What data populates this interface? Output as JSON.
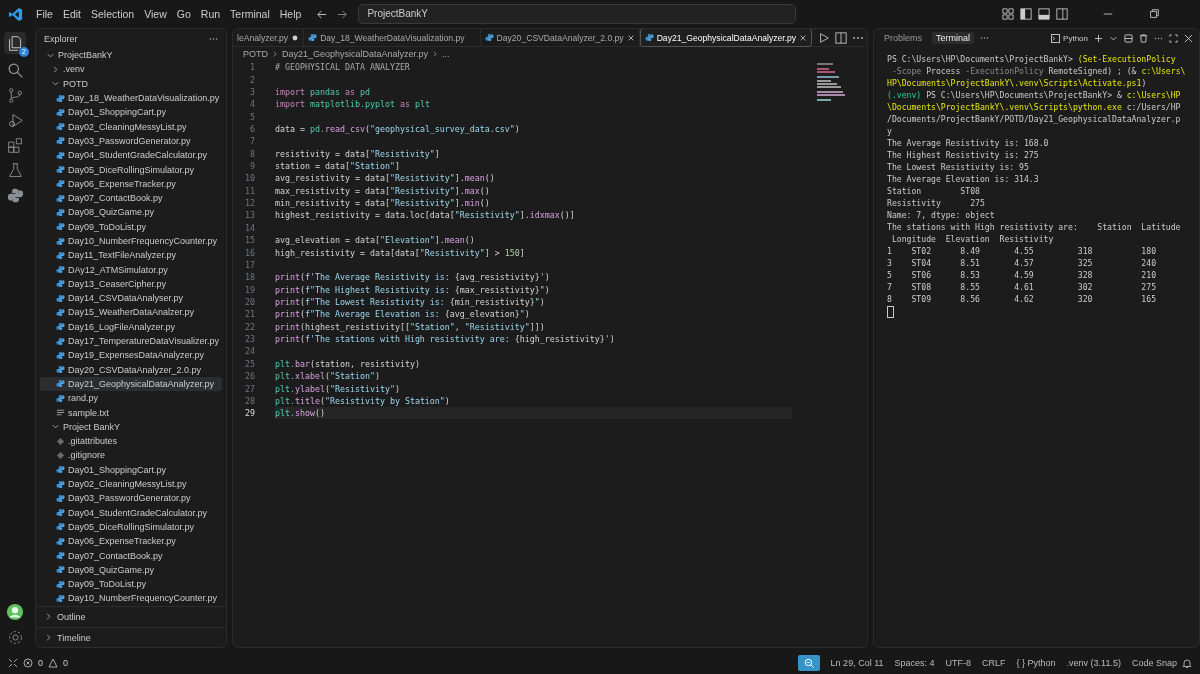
{
  "title_bar": {
    "menu": [
      "File",
      "Edit",
      "Selection",
      "View",
      "Go",
      "Run",
      "Terminal",
      "Help"
    ],
    "search": {
      "value": "ProjectBankY"
    }
  },
  "activity_bar": {
    "badge": "2"
  },
  "explorer": {
    "title": "Explorer",
    "tree": [
      {
        "label": "ProjectBankY",
        "kind": "folder",
        "expanded": true,
        "selected": false,
        "children": [
          {
            "label": ".venv",
            "kind": "folder",
            "expanded": false,
            "selected": false
          },
          {
            "label": "POTD",
            "kind": "folder",
            "expanded": true,
            "selected": false,
            "children": [
              {
                "label": "Day_18_WeatherDataVisualization.py",
                "kind": "python",
                "selected": false
              },
              {
                "label": "Day01_ShoppingCart.py",
                "kind": "python",
                "selected": false
              },
              {
                "label": "Day02_CleaningMessyList.py",
                "kind": "python",
                "selected": false
              },
              {
                "label": "Day03_PasswordGenerator.py",
                "kind": "python",
                "selected": false
              },
              {
                "label": "Day04_StudentGradeCalculator.py",
                "kind": "python",
                "selected": false
              },
              {
                "label": "Day05_DiceRollingSimulator.py",
                "kind": "python",
                "selected": false
              },
              {
                "label": "Day06_ExpenseTracker.py",
                "kind": "python",
                "selected": false
              },
              {
                "label": "Day07_ContactBook.py",
                "kind": "python",
                "selected": false
              },
              {
                "label": "Day08_QuizGame.py",
                "kind": "python",
                "selected": false
              },
              {
                "label": "Day09_ToDoList.py",
                "kind": "python",
                "selected": false
              },
              {
                "label": "Day10_NumberFrequencyCounter.py",
                "kind": "python",
                "selected": false
              },
              {
                "label": "Day11_TextFileAnalyzer.py",
                "kind": "python",
                "selected": false
              },
              {
                "label": "DAy12_ATMSimulator.py",
                "kind": "python",
                "selected": false
              },
              {
                "label": "Day13_CeaserCipher.py",
                "kind": "python",
                "selected": false
              },
              {
                "label": "Day14_CSVDataAnalyser.py",
                "kind": "python",
                "selected": false
              },
              {
                "label": "Day15_WeatherDataAnalzer.py",
                "kind": "python",
                "selected": false
              },
              {
                "label": "Day16_LogFileAnalyzer.py",
                "kind": "python",
                "selected": false
              },
              {
                "label": "Day17_TemperatureDataVisualizer.py",
                "kind": "python",
                "selected": false
              },
              {
                "label": "Day19_ExpensesDataAnalyzer.py",
                "kind": "python",
                "selected": false
              },
              {
                "label": "Day20_CSVDataAnalyzer_2.0.py",
                "kind": "python",
                "selected": false
              },
              {
                "label": "Day21_GeophysicalDataAnalyzer.py",
                "kind": "python",
                "selected": true
              },
              {
                "label": "rand.py",
                "kind": "python",
                "selected": false
              },
              {
                "label": "sample.txt",
                "kind": "text",
                "selected": false
              }
            ]
          },
          {
            "label": "Project BankY",
            "kind": "folder",
            "expanded": true,
            "selected": false,
            "children": [
              {
                "label": ".gitattributes",
                "kind": "git",
                "selected": false
              },
              {
                "label": ".gitignore",
                "kind": "git",
                "selected": false
              },
              {
                "label": "Day01_ShoppingCart.py",
                "kind": "python",
                "selected": false
              },
              {
                "label": "Day02_CleaningMessyList.py",
                "kind": "python",
                "selected": false
              },
              {
                "label": "Day03_PasswordGenerator.py",
                "kind": "python",
                "selected": false
              },
              {
                "label": "Day04_StudentGradeCalculator.py",
                "kind": "python",
                "selected": false
              },
              {
                "label": "Day05_DiceRollingSimulator.py",
                "kind": "python",
                "selected": false
              },
              {
                "label": "Day06_ExpenseTracker.py",
                "kind": "python",
                "selected": false
              },
              {
                "label": "Day07_ContactBook.py",
                "kind": "python",
                "selected": false
              },
              {
                "label": "Day08_QuizGame.py",
                "kind": "python",
                "selected": false
              },
              {
                "label": "Day09_ToDoList.py",
                "kind": "python",
                "selected": false
              },
              {
                "label": "Day10_NumberFrequencyCounter.py",
                "kind": "python",
                "selected": false
              }
            ]
          }
        ]
      }
    ],
    "sections": [
      {
        "label": "Outline",
        "expanded": false
      },
      {
        "label": "Timeline",
        "expanded": false
      }
    ]
  },
  "tabs": [
    {
      "label": "leAnalyzer.py",
      "kind": "partial",
      "selected": false,
      "modified": true
    },
    {
      "label": "Day_18_WeatherDataVisualization.py",
      "kind": "python",
      "selected": false,
      "modified": false,
      "close_visible": false
    },
    {
      "label": "Day20_CSVDataAnalyzer_2.0.py",
      "kind": "python",
      "selected": false,
      "modified": false,
      "close_visible": true
    },
    {
      "label": "Day21_GeophysicalDataAnalyzer.py",
      "kind": "python",
      "selected": true,
      "modified": false,
      "close_visible": true
    }
  ],
  "breadcrumb": [
    "POTD",
    "Day21_GeophysicalDataAnalyzer.py",
    "..."
  ],
  "code": [
    {
      "number": "1",
      "current": false,
      "tokens": [
        {
          "text": "# GEOPHYSICAL DATA ANALYZER",
          "kind": "comment"
        }
      ]
    },
    {
      "number": "2",
      "current": false
    },
    {
      "number": "3",
      "current": false,
      "tokens": [
        {
          "text": "import",
          "kind": "kw"
        },
        {
          "text": " pandas",
          "kind": "mod"
        },
        {
          "text": " as",
          "kind": "kw"
        },
        {
          "text": " pd",
          "kind": "mod"
        }
      ]
    },
    {
      "number": "4",
      "current": false,
      "tokens": [
        {
          "text": "import",
          "kind": "kw"
        },
        {
          "text": " matplotlib.pyplot",
          "kind": "mod"
        },
        {
          "text": " as",
          "kind": "kw"
        },
        {
          "text": " plt",
          "kind": "mod"
        }
      ]
    },
    {
      "number": "5",
      "current": false
    },
    {
      "number": "6",
      "current": false,
      "tokens": [
        {
          "text": "data = ",
          "kind": "plain"
        },
        {
          "text": "pd.",
          "kind": "mod"
        },
        {
          "text": "read_csv",
          "kind": "fn"
        },
        {
          "text": "(",
          "kind": "plain"
        },
        {
          "text": "\"geophysical_survey_data.csv\"",
          "kind": "str"
        },
        {
          "text": ")",
          "kind": "plain"
        }
      ]
    },
    {
      "number": "7",
      "current": false
    },
    {
      "number": "8",
      "current": false,
      "tokens": [
        {
          "text": "resistivity = data[",
          "kind": "plain"
        },
        {
          "text": "\"Resistivity\"",
          "kind": "str"
        },
        {
          "text": "]",
          "kind": "plain"
        }
      ]
    },
    {
      "number": "9",
      "current": false,
      "tokens": [
        {
          "text": "station = data[",
          "kind": "plain"
        },
        {
          "text": "\"Station\"",
          "kind": "str"
        },
        {
          "text": "]",
          "kind": "plain"
        }
      ]
    },
    {
      "number": "10",
      "current": false,
      "tokens": [
        {
          "text": "avg_resistivity = data[",
          "kind": "plain"
        },
        {
          "text": "\"Resistivity\"",
          "kind": "str"
        },
        {
          "text": "].",
          "kind": "plain"
        },
        {
          "text": "mean",
          "kind": "fn"
        },
        {
          "text": "()",
          "kind": "plain"
        }
      ]
    },
    {
      "number": "11",
      "current": false,
      "tokens": [
        {
          "text": "max_resistivity = data[",
          "kind": "plain"
        },
        {
          "text": "\"Resistivity\"",
          "kind": "str"
        },
        {
          "text": "].",
          "kind": "plain"
        },
        {
          "text": "max",
          "kind": "fn"
        },
        {
          "text": "()",
          "kind": "plain"
        }
      ]
    },
    {
      "number": "12",
      "current": false,
      "tokens": [
        {
          "text": "min_resistivity = data[",
          "kind": "plain"
        },
        {
          "text": "\"Resistivity\"",
          "kind": "str"
        },
        {
          "text": "].",
          "kind": "plain"
        },
        {
          "text": "min",
          "kind": "fn"
        },
        {
          "text": "()",
          "kind": "plain"
        }
      ]
    },
    {
      "number": "13",
      "current": false,
      "tokens": [
        {
          "text": "highest_resistivity = data.loc[data[",
          "kind": "plain"
        },
        {
          "text": "\"Resistivity\"",
          "kind": "str"
        },
        {
          "text": "].",
          "kind": "plain"
        },
        {
          "text": "idxmax",
          "kind": "fn"
        },
        {
          "text": "()]",
          "kind": "plain"
        }
      ]
    },
    {
      "number": "14",
      "current": false
    },
    {
      "number": "15",
      "current": false,
      "tokens": [
        {
          "text": "avg_elevation = data[",
          "kind": "plain"
        },
        {
          "text": "\"Elevation\"",
          "kind": "str"
        },
        {
          "text": "].",
          "kind": "plain"
        },
        {
          "text": "mean",
          "kind": "fn"
        },
        {
          "text": "()",
          "kind": "plain"
        }
      ]
    },
    {
      "number": "16",
      "current": false,
      "tokens": [
        {
          "text": "high_resistivity = data[data[",
          "kind": "plain"
        },
        {
          "text": "\"Resistivity\"",
          "kind": "str"
        },
        {
          "text": "] > ",
          "kind": "plain"
        },
        {
          "text": "150",
          "kind": "num"
        },
        {
          "text": "]",
          "kind": "plain"
        }
      ]
    },
    {
      "number": "17",
      "current": false
    },
    {
      "number": "18",
      "current": false,
      "tokens": [
        {
          "text": "print",
          "kind": "fn"
        },
        {
          "text": "(",
          "kind": "plain"
        },
        {
          "text": "f'The Average Resistivity is: ",
          "kind": "str"
        },
        {
          "text": "{avg_resistivity}",
          "kind": "plain"
        },
        {
          "text": "'",
          "kind": "str"
        },
        {
          "text": ")",
          "kind": "plain"
        }
      ]
    },
    {
      "number": "19",
      "current": false,
      "tokens": [
        {
          "text": "print",
          "kind": "fn"
        },
        {
          "text": "(",
          "kind": "plain"
        },
        {
          "text": "f\"The Highest Resistivity is: ",
          "kind": "str"
        },
        {
          "text": "{max_resistivity}",
          "kind": "plain"
        },
        {
          "text": "\"",
          "kind": "str"
        },
        {
          "text": ")",
          "kind": "plain"
        }
      ]
    },
    {
      "number": "20",
      "current": false,
      "tokens": [
        {
          "text": "print",
          "kind": "fn"
        },
        {
          "text": "(",
          "kind": "plain"
        },
        {
          "text": "f\"The Lowest Resistivity is: ",
          "kind": "str"
        },
        {
          "text": "{min_resistivity}",
          "kind": "plain"
        },
        {
          "text": "\"",
          "kind": "str"
        },
        {
          "text": ")",
          "kind": "plain"
        }
      ]
    },
    {
      "number": "21",
      "current": false,
      "tokens": [
        {
          "text": "print",
          "kind": "fn"
        },
        {
          "text": "(",
          "kind": "plain"
        },
        {
          "text": "f\"The Average Elevation is: ",
          "kind": "str"
        },
        {
          "text": "{avg_elevation}",
          "kind": "plain"
        },
        {
          "text": "\"",
          "kind": "str"
        },
        {
          "text": ")",
          "kind": "plain"
        }
      ]
    },
    {
      "number": "22",
      "current": false,
      "tokens": [
        {
          "text": "print",
          "kind": "fn"
        },
        {
          "text": "(highest_resistivity[[",
          "kind": "plain"
        },
        {
          "text": "\"Station\"",
          "kind": "str"
        },
        {
          "text": ", ",
          "kind": "plain"
        },
        {
          "text": "\"Resistivity\"",
          "kind": "str"
        },
        {
          "text": "]])",
          "kind": "plain"
        }
      ]
    },
    {
      "number": "23",
      "current": false,
      "tokens": [
        {
          "text": "print",
          "kind": "fn"
        },
        {
          "text": "(",
          "kind": "plain"
        },
        {
          "text": "f'The stations with High resistivity are: ",
          "kind": "str"
        },
        {
          "text": "{high_resistivity}",
          "kind": "plain"
        },
        {
          "text": "'",
          "kind": "str"
        },
        {
          "text": ")",
          "kind": "plain"
        }
      ]
    },
    {
      "number": "24",
      "current": false
    },
    {
      "number": "25",
      "current": false,
      "tokens": [
        {
          "text": "plt.",
          "kind": "mod"
        },
        {
          "text": "bar",
          "kind": "fn"
        },
        {
          "text": "(station, resistivity)",
          "kind": "plain"
        }
      ]
    },
    {
      "number": "26",
      "current": false,
      "tokens": [
        {
          "text": "plt.",
          "kind": "mod"
        },
        {
          "text": "xlabel",
          "kind": "fn"
        },
        {
          "text": "(",
          "kind": "plain"
        },
        {
          "text": "\"Station\"",
          "kind": "str"
        },
        {
          "text": ")",
          "kind": "plain"
        }
      ]
    },
    {
      "number": "27",
      "current": false,
      "tokens": [
        {
          "text": "plt.",
          "kind": "mod"
        },
        {
          "text": "ylabel",
          "kind": "fn"
        },
        {
          "text": "(",
          "kind": "plain"
        },
        {
          "text": "\"Resistivity\"",
          "kind": "str"
        },
        {
          "text": ")",
          "kind": "plain"
        }
      ]
    },
    {
      "number": "28",
      "current": false,
      "tokens": [
        {
          "text": "plt.",
          "kind": "mod"
        },
        {
          "text": "title",
          "kind": "fn"
        },
        {
          "text": "(",
          "kind": "plain"
        },
        {
          "text": "\"Resistivity by Station\"",
          "kind": "str"
        },
        {
          "text": ")",
          "kind": "plain"
        }
      ]
    },
    {
      "number": "29",
      "current": true,
      "tokens": [
        {
          "text": "plt.",
          "kind": "mod"
        },
        {
          "text": "show",
          "kind": "fn"
        },
        {
          "text": "()",
          "kind": "plain"
        }
      ]
    }
  ],
  "panel": {
    "tabs": [
      {
        "label": "Problems",
        "selected": false
      },
      {
        "label": "Terminal",
        "selected": true
      }
    ],
    "shell": "Python",
    "terminal": [
      [
        {
          "text": "PS C:\\Users\\HP\\Documents\\ProjectBankY> ",
          "kind": "plain"
        },
        {
          "text": "(Set-ExecutionPolicy",
          "kind": "cmd"
        }
      ],
      [
        {
          "text": " -Scope",
          "kind": "dim"
        },
        {
          "text": " Process ",
          "kind": "plain"
        },
        {
          "text": "-ExecutionPolicy",
          "kind": "dim"
        },
        {
          "text": " RemoteSigned) ; (& ",
          "kind": "plain"
        },
        {
          "text": "c:\\Users\\",
          "kind": "cmd"
        }
      ],
      [
        {
          "text": "HP\\Documents\\ProjectBankY\\.venv\\Scripts\\Activate.ps1",
          "kind": "cmd"
        },
        {
          "text": ")",
          "kind": "plain"
        }
      ],
      [
        {
          "text": "(.venv)",
          "kind": "venv"
        },
        {
          "text": " PS C:\\Users\\HP\\Documents\\ProjectBankY> & ",
          "kind": "plain"
        },
        {
          "text": "c:\\Users\\HP",
          "kind": "cmd"
        }
      ],
      [
        {
          "text": "\\Documents\\ProjectBankY\\.venv\\Scripts\\python.exe",
          "kind": "cmd"
        },
        {
          "text": " c:/Users/HP",
          "kind": "plain"
        }
      ],
      [
        {
          "text": "/Documents/ProjectBankY/POTD/Day21_GeophysicalDataAnalyzer.p",
          "kind": "plain"
        }
      ],
      [
        {
          "text": "y",
          "kind": "plain"
        }
      ],
      [
        {
          "text": "The Average Resistivity is: 168.0",
          "kind": "plain"
        }
      ],
      [
        {
          "text": "The Highest Resistivity is: 275",
          "kind": "plain"
        }
      ],
      [
        {
          "text": "The Lowest Resistivity is: 95",
          "kind": "plain"
        }
      ],
      [
        {
          "text": "The Average Elevation is: 314.3",
          "kind": "plain"
        }
      ],
      [
        {
          "text": "Station        ST08",
          "kind": "plain"
        }
      ],
      [
        {
          "text": "Resistivity      275",
          "kind": "plain"
        }
      ],
      [
        {
          "text": "Name: 7, dtype: object",
          "kind": "plain"
        }
      ],
      [
        {
          "text": "The stations with High resistivity are:    Station  Latitude",
          "kind": "plain"
        }
      ],
      [
        {
          "text": " Longitude  Elevation  Resistivity",
          "kind": "plain"
        }
      ],
      [
        {
          "text": "1    ST02      8.49       4.55         318          180",
          "kind": "plain"
        }
      ],
      [
        {
          "text": "3    ST04      8.51       4.57         325          240",
          "kind": "plain"
        }
      ],
      [
        {
          "text": "5    ST06      8.53       4.59         328          210",
          "kind": "plain"
        }
      ],
      [
        {
          "text": "7    ST08      8.55       4.61         302          275",
          "kind": "plain"
        }
      ],
      [
        {
          "text": "8    ST09      8.56       4.62         320          165",
          "kind": "plain"
        }
      ]
    ]
  },
  "status_bar": {
    "errors": "0",
    "warnings": "0",
    "items": [
      "Ln 29, Col 11",
      "Spaces: 4",
      "UTF-8",
      "CRLF",
      "{ } Python",
      ".venv (3.11.5)",
      "Code Snap"
    ]
  }
}
